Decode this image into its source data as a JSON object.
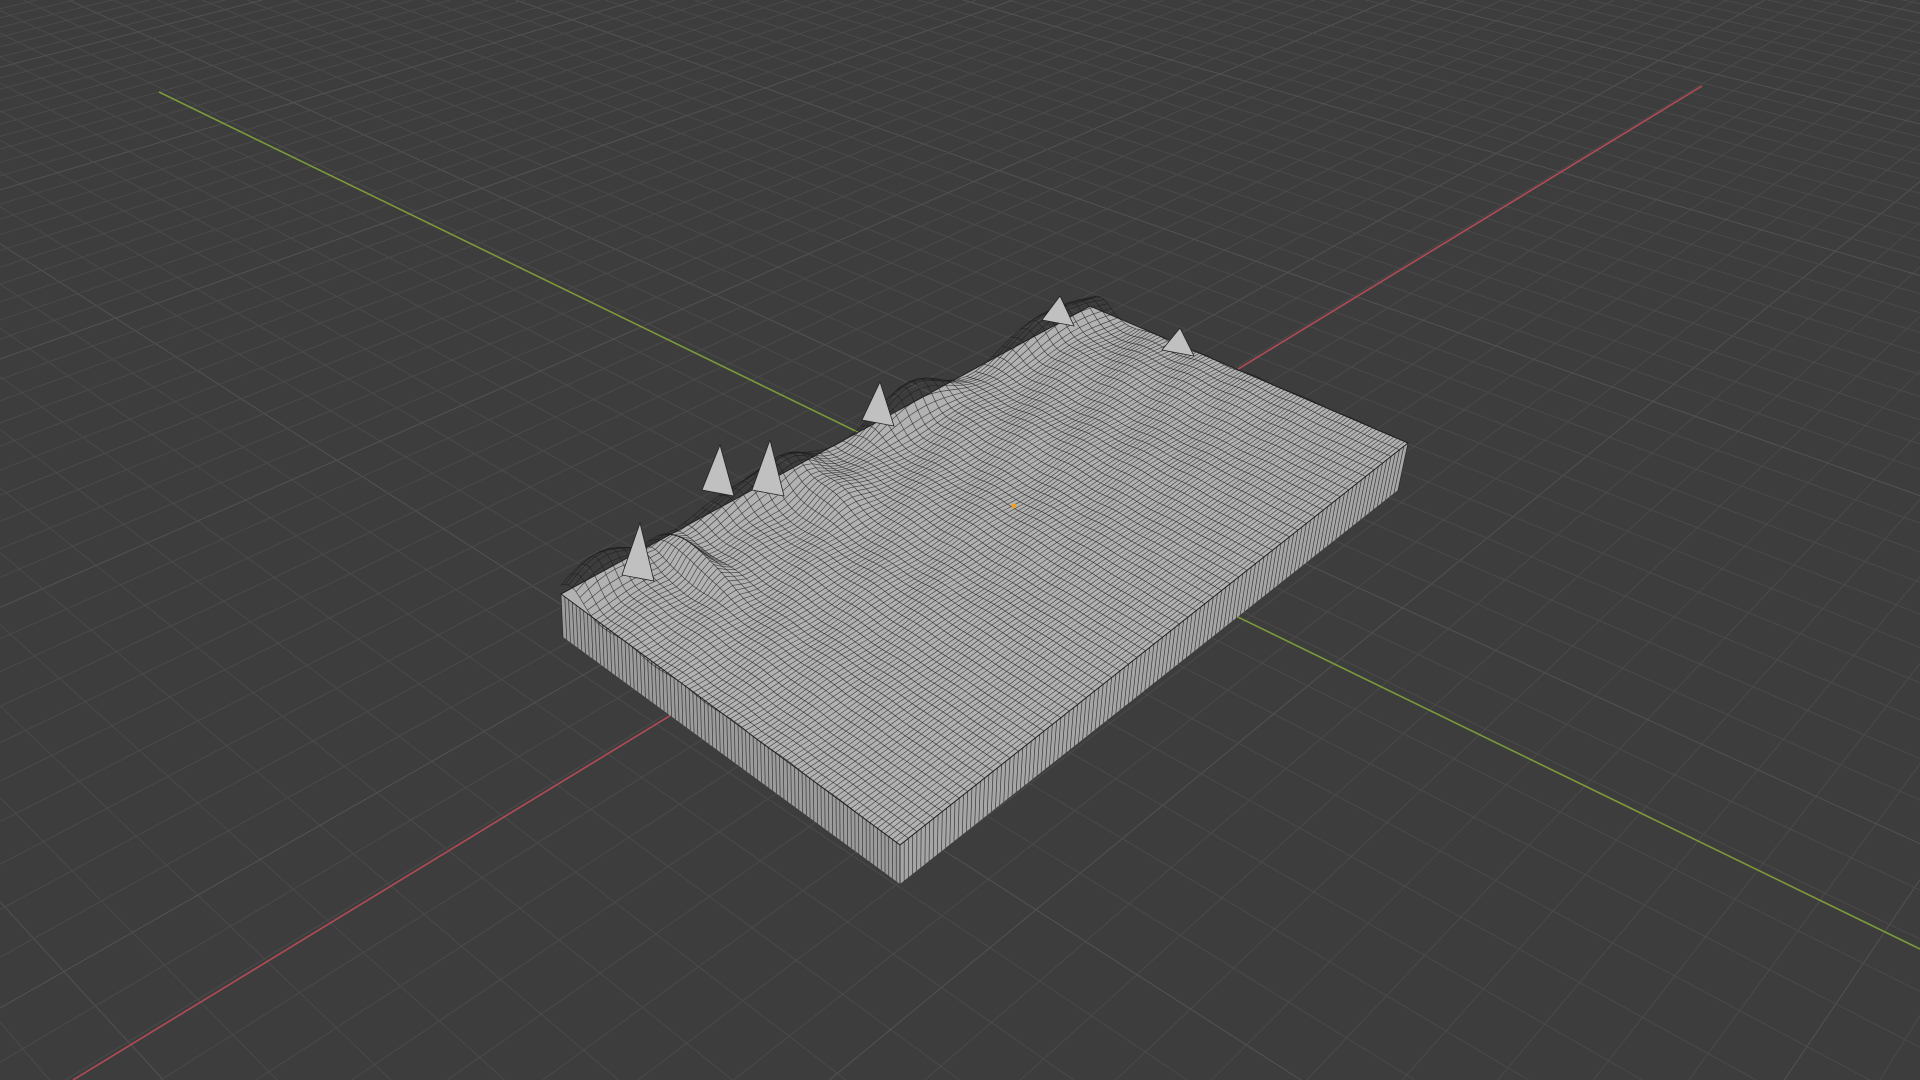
{
  "viewport": {
    "mode": "3d-viewport",
    "background_color": "#3d3d3d",
    "grid_color": "#4a4a4a",
    "grid_major_color": "#525252",
    "x_axis_color": "#b34b55",
    "y_axis_color": "#7d9a3a",
    "object": {
      "type": "terrain-mesh",
      "display": "wireframe-overlay",
      "top_color": "#b2b2b2",
      "side_color": "#9c9c9c",
      "wire_color": "#1e1e1e",
      "origin_color": "#f0a020"
    }
  }
}
